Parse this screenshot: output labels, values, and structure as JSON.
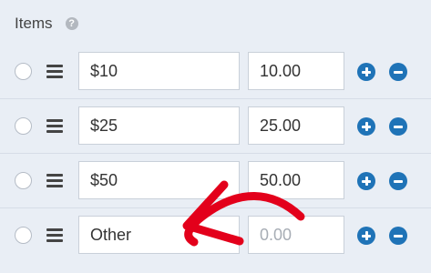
{
  "header": {
    "title": "Items",
    "help_icon": "question-circle-icon"
  },
  "rows": [
    {
      "label": "$10",
      "value": "10.00",
      "value_is_placeholder": false
    },
    {
      "label": "$25",
      "value": "25.00",
      "value_is_placeholder": false
    },
    {
      "label": "$50",
      "value": "50.00",
      "value_is_placeholder": false
    },
    {
      "label": "Other",
      "value": "0.00",
      "value_is_placeholder": true
    }
  ],
  "icons": {
    "radio": "radio-circle-icon",
    "handle": "drag-handle-icon",
    "add": "plus-circle-icon",
    "remove": "minus-circle-icon"
  },
  "colors": {
    "background": "#e9eef5",
    "accent": "#1f73b7",
    "annotation_arrow": "#e3001b"
  }
}
